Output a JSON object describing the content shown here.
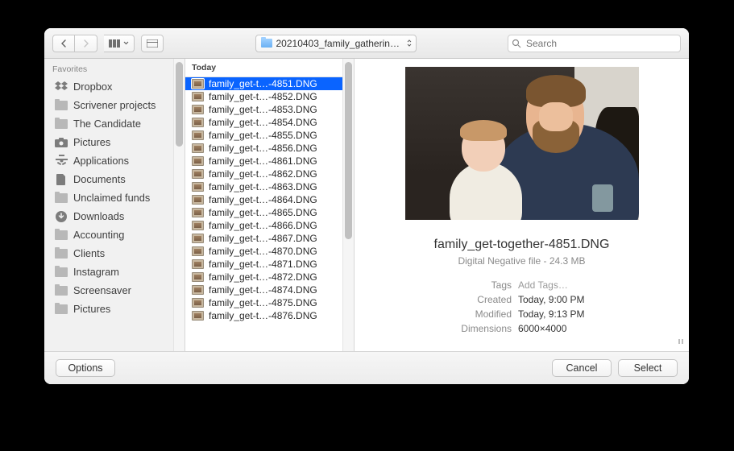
{
  "toolbar": {
    "folder_name": "20210403_family_gatherin…",
    "search_placeholder": "Search"
  },
  "sidebar": {
    "heading": "Favorites",
    "items": [
      {
        "label": "Dropbox",
        "icon": "dropbox"
      },
      {
        "label": "Scrivener projects",
        "icon": "folder"
      },
      {
        "label": "The Candidate",
        "icon": "folder"
      },
      {
        "label": "Pictures",
        "icon": "camera"
      },
      {
        "label": "Applications",
        "icon": "app"
      },
      {
        "label": "Documents",
        "icon": "doc"
      },
      {
        "label": "Unclaimed funds",
        "icon": "folder"
      },
      {
        "label": "Downloads",
        "icon": "download"
      },
      {
        "label": "Accounting",
        "icon": "folder"
      },
      {
        "label": "Clients",
        "icon": "folder"
      },
      {
        "label": "Instagram",
        "icon": "folder"
      },
      {
        "label": "Screensaver",
        "icon": "folder"
      },
      {
        "label": "Pictures",
        "icon": "folder"
      }
    ]
  },
  "filelist": {
    "heading": "Today",
    "rows": [
      "family_get-t…-4851.DNG",
      "family_get-t…-4852.DNG",
      "family_get-t…-4853.DNG",
      "family_get-t…-4854.DNG",
      "family_get-t…-4855.DNG",
      "family_get-t…-4856.DNG",
      "family_get-t…-4861.DNG",
      "family_get-t…-4862.DNG",
      "family_get-t…-4863.DNG",
      "family_get-t…-4864.DNG",
      "family_get-t…-4865.DNG",
      "family_get-t…-4866.DNG",
      "family_get-t…-4867.DNG",
      "family_get-t…-4870.DNG",
      "family_get-t…-4871.DNG",
      "family_get-t…-4872.DNG",
      "family_get-t…-4874.DNG",
      "family_get-t…-4875.DNG",
      "family_get-t…-4876.DNG"
    ],
    "selected_index": 0
  },
  "preview": {
    "filename": "family_get-together-4851.DNG",
    "subtitle": "Digital Negative file - 24.3 MB",
    "tags_label": "Tags",
    "tags_value": "Add Tags…",
    "created_label": "Created",
    "created_value": "Today, 9:00 PM",
    "modified_label": "Modified",
    "modified_value": "Today, 9:13 PM",
    "dimensions_label": "Dimensions",
    "dimensions_value": "6000×4000"
  },
  "footer": {
    "options": "Options",
    "cancel": "Cancel",
    "select": "Select"
  }
}
